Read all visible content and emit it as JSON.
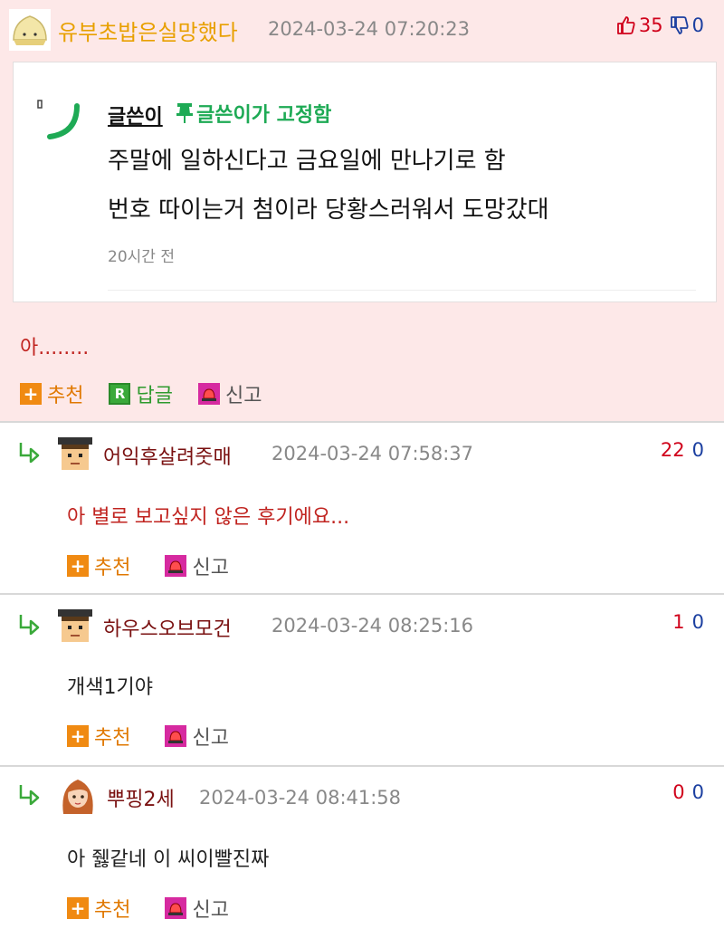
{
  "top_comment": {
    "author": "유부초밥은실망했다",
    "date": "2024-03-24 07:20:23",
    "upvotes": "35",
    "downvotes": "0",
    "body": "아........",
    "actions": {
      "recommend": "추천",
      "reply": "답글",
      "report": "신고"
    },
    "embed": {
      "author": "글쓴이",
      "pinned_label": "글쓴이가 고정함",
      "line1": "주말에 일하신다고 금요일에 만나기로 함",
      "line2": "번호 따이는거 첨이라 당황스러워서 도망갔대",
      "time": "20시간 전"
    }
  },
  "replies": [
    {
      "author": "어익후살려줏매",
      "date": "2024-03-24 07:58:37",
      "upvotes": "22",
      "downvotes": "0",
      "body": "아 별로 보고싶지 않은 후기에요...",
      "body_color": "#c0231f",
      "recommend": "추천",
      "report": "신고"
    },
    {
      "author": "하우스오브모건",
      "date": "2024-03-24 08:25:16",
      "upvotes": "1",
      "downvotes": "0",
      "body": "개색1기야",
      "body_color": "#222222",
      "recommend": "추천",
      "report": "신고"
    },
    {
      "author": "뿌핑2세",
      "date": "2024-03-24 08:41:58",
      "upvotes": "0",
      "downvotes": "0",
      "body": "아 쥃같네 이 씨이빨진짜",
      "body_color": "#222222",
      "recommend": "추천",
      "report": "신고"
    }
  ],
  "colors": {
    "top_bg": "#fde8e8",
    "author_gold": "#e8a000",
    "reply_author": "#7a1111",
    "upvote": "#d0021b",
    "downvote": "#1b3fa0",
    "pin_green": "#1eaa55"
  }
}
